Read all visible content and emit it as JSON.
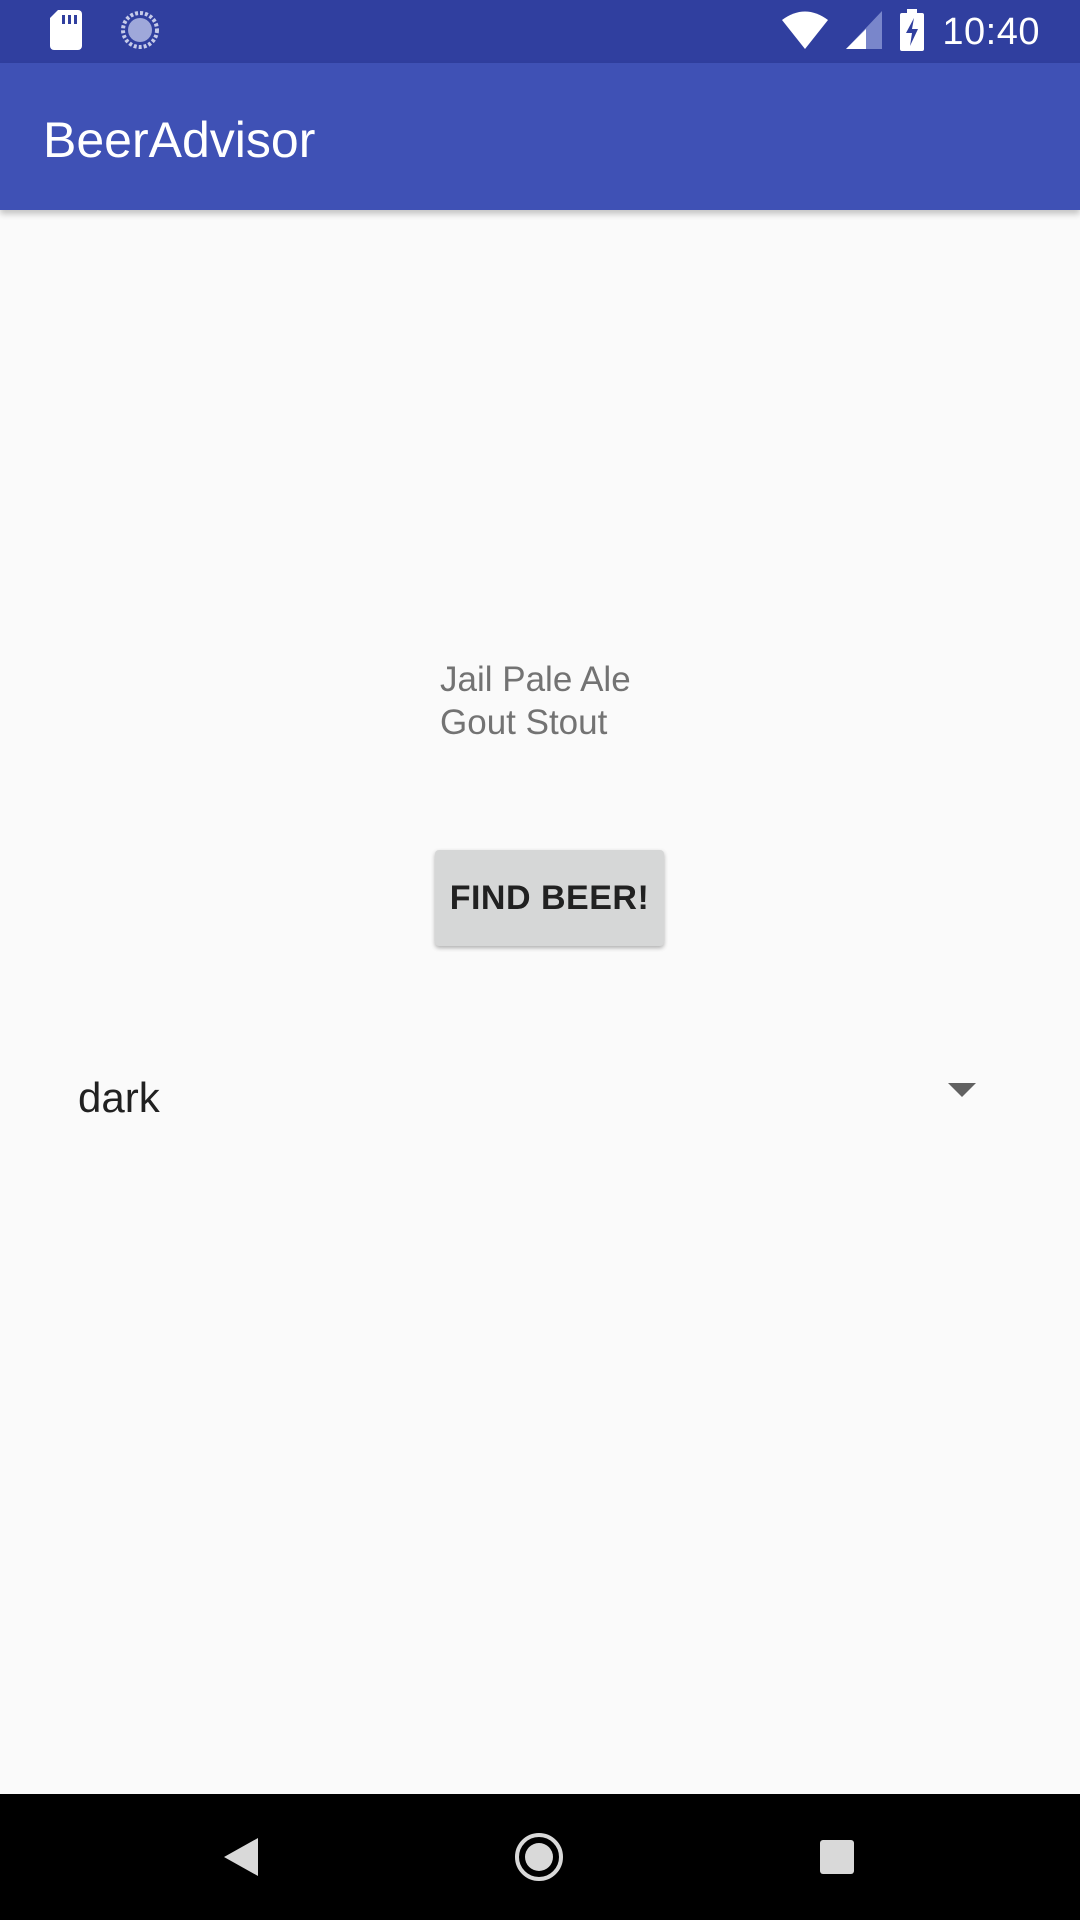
{
  "status_bar": {
    "time": "10:40",
    "icons": [
      "sd-card-icon",
      "sync-icon",
      "wifi-icon",
      "cell-signal-icon",
      "battery-charging-icon"
    ]
  },
  "app_bar": {
    "title": "BeerAdvisor",
    "color": "#3f51b5"
  },
  "main": {
    "brands": [
      "Jail Pale Ale",
      "Gout Stout"
    ],
    "find_button_label": "FIND BEER!",
    "spinner_value": "dark"
  },
  "nav_bar": {
    "icons": [
      "back-icon",
      "home-icon",
      "recents-icon"
    ]
  },
  "colors": {
    "status_bar": "#303f9f",
    "background": "#fafafa",
    "button": "#d6d7d7"
  }
}
